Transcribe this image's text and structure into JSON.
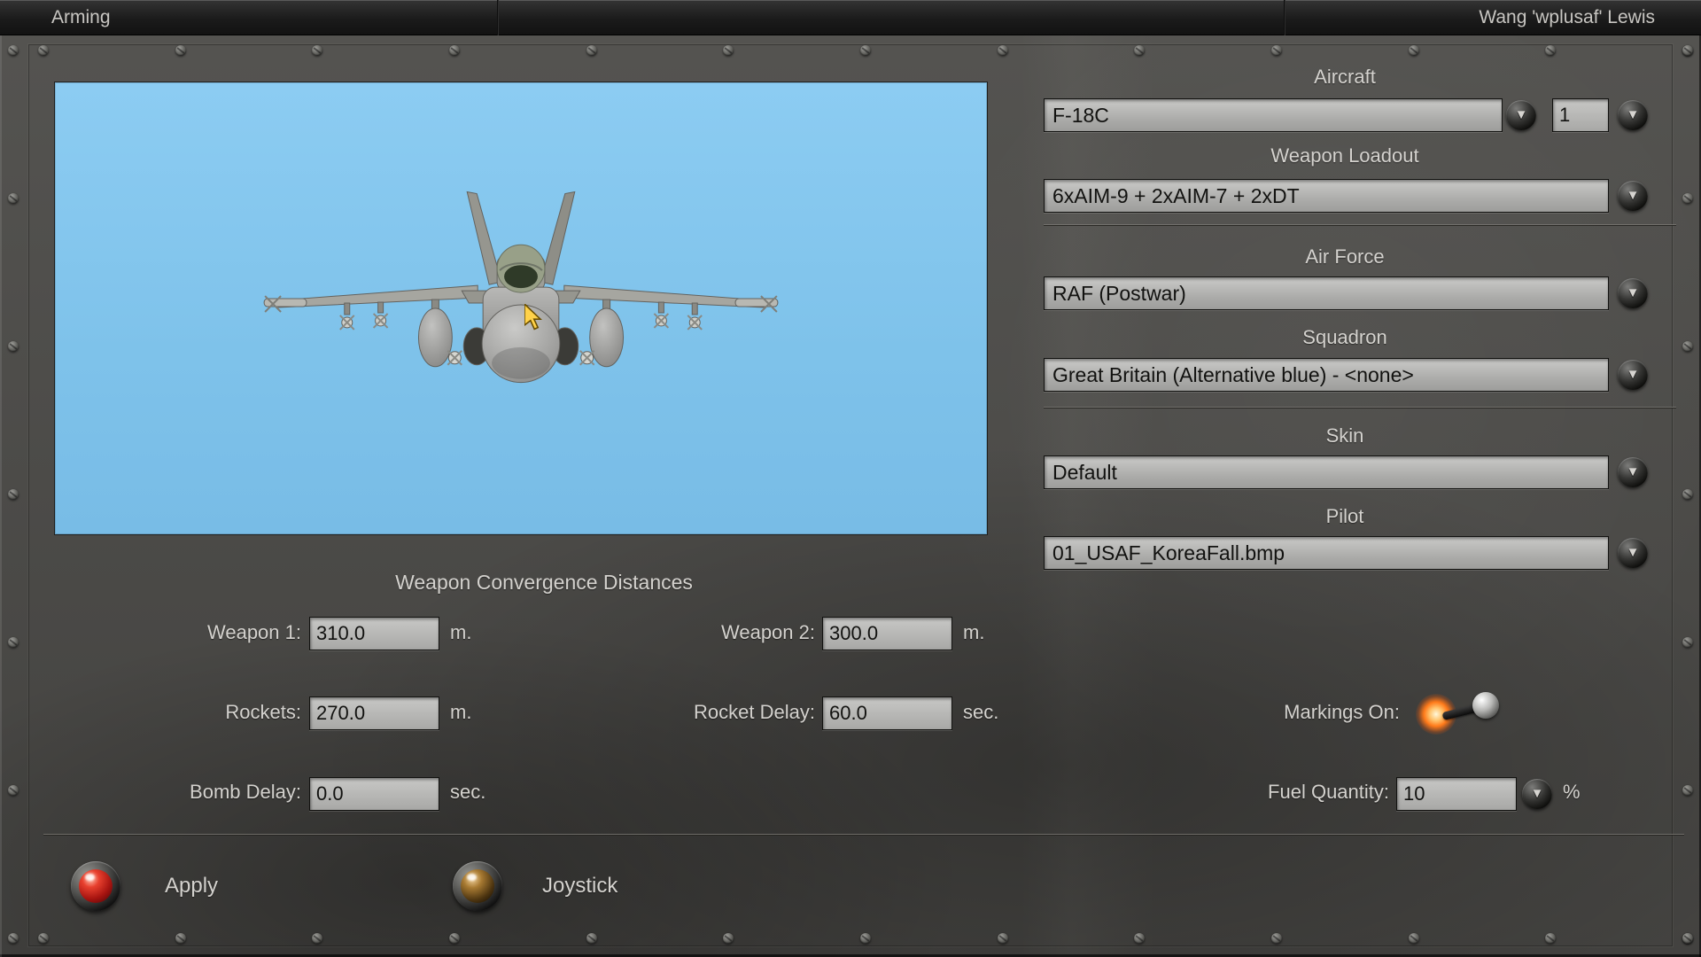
{
  "header": {
    "tab": "Arming",
    "player": "Wang 'wplusaf' Lewis"
  },
  "selectors": {
    "aircraft": {
      "label": "Aircraft",
      "value": "F-18C",
      "count": "1"
    },
    "loadout": {
      "label": "Weapon Loadout",
      "value": "6xAIM-9 + 2xAIM-7 + 2xDT"
    },
    "air_force": {
      "label": "Air Force",
      "value": "RAF (Postwar)"
    },
    "squadron": {
      "label": "Squadron",
      "value": "Great Britain (Alternative blue) - <none>"
    },
    "skin": {
      "label": "Skin",
      "value": "Default"
    },
    "pilot": {
      "label": "Pilot",
      "value": "01_USAF_KoreaFall.bmp"
    }
  },
  "convergence": {
    "title": "Weapon Convergence Distances",
    "weapon1": {
      "label": "Weapon 1:",
      "value": "310.0",
      "unit": "m."
    },
    "weapon2": {
      "label": "Weapon 2:",
      "value": "300.0",
      "unit": "m."
    },
    "rockets": {
      "label": "Rockets:",
      "value": "270.0",
      "unit": "m."
    },
    "rocket_delay": {
      "label": "Rocket Delay:",
      "value": "60.0",
      "unit": "sec."
    },
    "bomb_delay": {
      "label": "Bomb Delay:",
      "value": "0.0",
      "unit": "sec."
    }
  },
  "options": {
    "markings": {
      "label": "Markings On:",
      "state": "on"
    },
    "fuel": {
      "label": "Fuel Quantity:",
      "value": "10",
      "unit": "%"
    }
  },
  "actions": {
    "apply": "Apply",
    "joystick": "Joystick"
  },
  "icons": {
    "dropdown_arrow": "▼"
  },
  "colors": {
    "sky": "#7ec2ea",
    "glow_orange": "#ff7a1a",
    "button_red": "#c41e14",
    "panel_gray": "#4e4d4a"
  }
}
